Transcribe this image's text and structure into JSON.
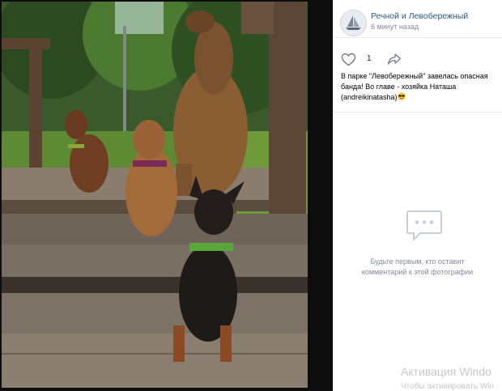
{
  "post": {
    "author": "Речной и Левобережный",
    "time": "6 минут назад",
    "likes": "1",
    "caption": "В парке \"Левобережный\" завелась опасная банда! Во главе - хозяйка Наташа (andreikinatasha)"
  },
  "comments": {
    "empty_line1": "Будьте первым, кто оставит",
    "empty_line2": "комментарий к этой фотографии"
  },
  "watermark": {
    "title": "Активация Windo",
    "subtitle": "Чтобы активировать Win"
  },
  "icons": {
    "like": "heart-icon",
    "share": "share-arrow-icon",
    "comments": "speech-bubble-icon",
    "emoji": "sunglasses-emoji-icon"
  },
  "colors": {
    "link": "#2a5885",
    "muted": "#818c99"
  }
}
